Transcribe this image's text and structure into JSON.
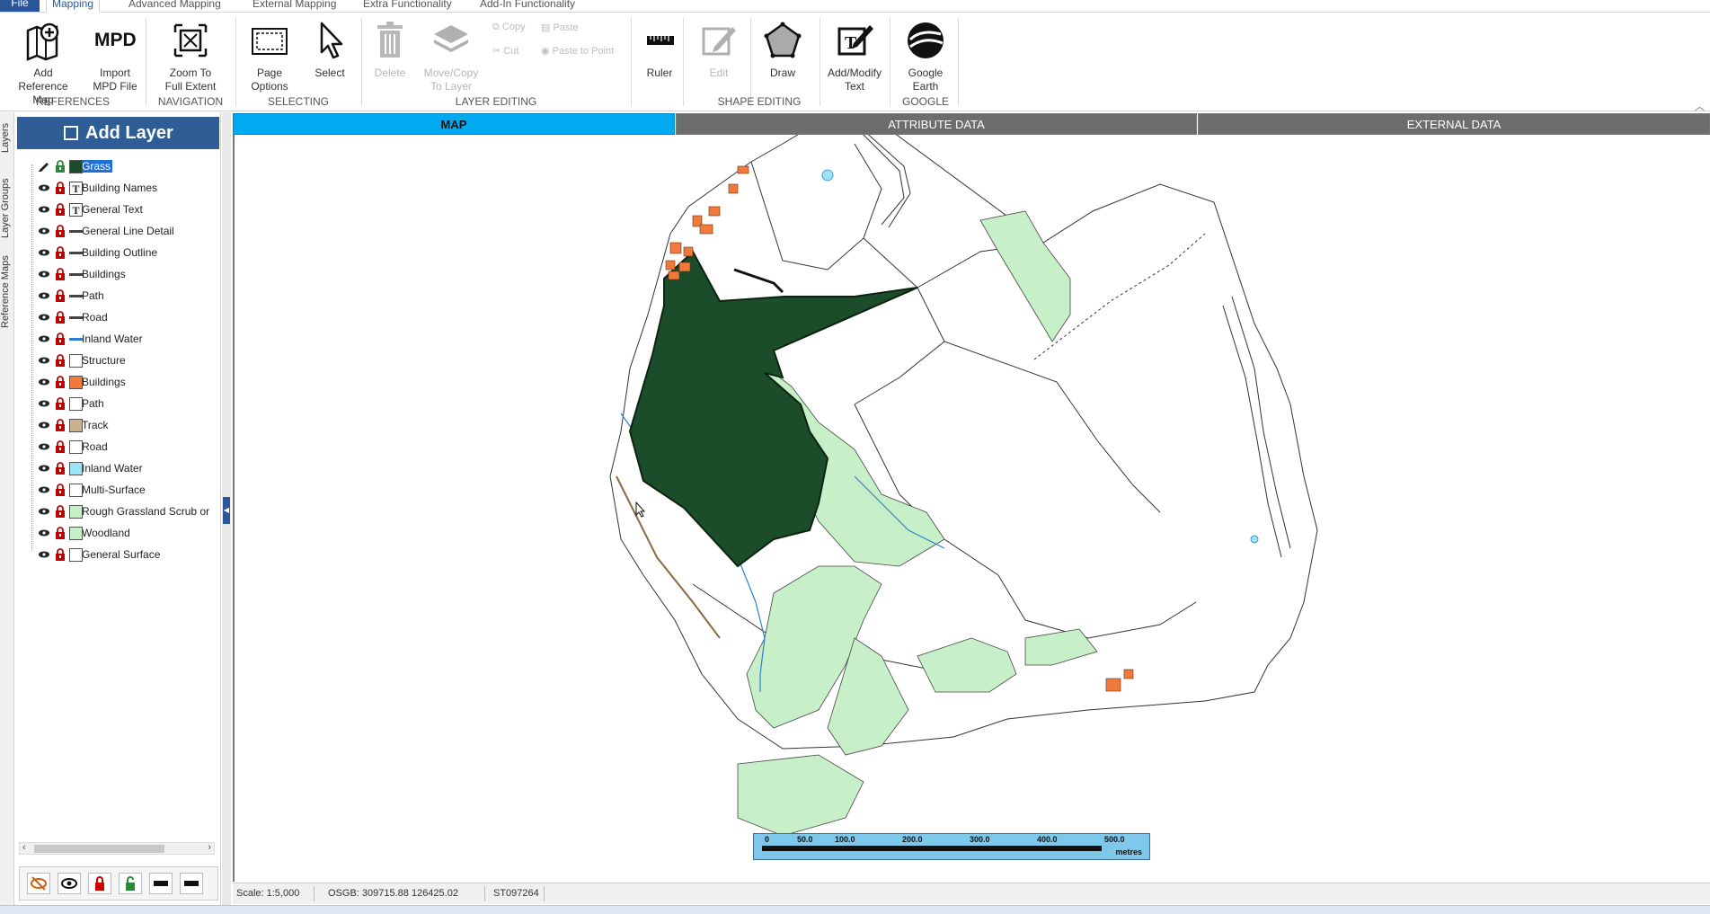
{
  "ribbon_tabs": [
    {
      "label": "File"
    },
    {
      "label": "Mapping"
    },
    {
      "label": "Advanced Mapping"
    },
    {
      "label": "External Mapping"
    },
    {
      "label": "Extra Functionality"
    },
    {
      "label": "Add-In Functionality"
    }
  ],
  "ribbon": {
    "add_reference_map": "Add Reference\nMap",
    "import_mpd": "Import\nMPD File",
    "mpd_icon_text": "MPD",
    "zoom_full_extent": "Zoom To\nFull Extent",
    "page_options": "Page\nOptions",
    "select": "Select",
    "delete": "Delete",
    "move_copy": "Move/Copy\nTo Layer",
    "copy": "Copy",
    "paste": "Paste",
    "cut": "Cut",
    "paste_to_point": "Paste to Point",
    "ruler": "Ruler",
    "edit": "Edit",
    "draw": "Draw",
    "add_modify_text": "Add/Modify\nText",
    "google_earth": "Google\nEarth",
    "groups": {
      "references": "REFERENCES",
      "navigation": "NAVIGATION",
      "selecting": "SELECTING",
      "layer_editing": "LAYER EDITING",
      "shape_editing": "SHAPE EDITING",
      "google": "GOOGLE"
    }
  },
  "side_tabs": {
    "layers": "Layers",
    "layer_groups": "Layer Groups",
    "reference_maps": "Reference Maps"
  },
  "panel": {
    "add_layer": "Add Layer"
  },
  "layers": [
    {
      "name": "Grass",
      "symbol": "fill",
      "color": "#1b4d2a",
      "selected": true
    },
    {
      "name": "Building Names",
      "symbol": "text",
      "color": "#333333"
    },
    {
      "name": "General Text",
      "symbol": "text",
      "color": "#333333"
    },
    {
      "name": "General Line Detail",
      "symbol": "line",
      "color": "#444444"
    },
    {
      "name": "Building Outline",
      "symbol": "line",
      "color": "#444444"
    },
    {
      "name": "Buildings",
      "symbol": "line",
      "color": "#444444"
    },
    {
      "name": "Path",
      "symbol": "line",
      "color": "#444444"
    },
    {
      "name": "Road",
      "symbol": "line",
      "color": "#444444"
    },
    {
      "name": "Inland Water",
      "symbol": "line",
      "color": "#2a7fd4"
    },
    {
      "name": "Structure",
      "symbol": "fill",
      "color": "#ffffff"
    },
    {
      "name": "Buildings",
      "symbol": "fill",
      "color": "#f07a3c"
    },
    {
      "name": "Path",
      "symbol": "fill",
      "color": "#ffffff"
    },
    {
      "name": "Track",
      "symbol": "fill",
      "color": "#cbb28f"
    },
    {
      "name": "Road",
      "symbol": "fill",
      "color": "#ffffff"
    },
    {
      "name": "Inland Water",
      "symbol": "fill",
      "color": "#9be4f8"
    },
    {
      "name": "Multi-Surface",
      "symbol": "fill",
      "color": "#ffffff"
    },
    {
      "name": "Rough Grassland Scrub or",
      "symbol": "fill",
      "color": "#c8f0c8"
    },
    {
      "name": "Woodland",
      "symbol": "fill",
      "color": "#c8f0c8"
    },
    {
      "name": "General Surface",
      "symbol": "fill",
      "color": "#ffffff"
    }
  ],
  "view_tabs": [
    {
      "label": "MAP",
      "active": true
    },
    {
      "label": "ATTRIBUTE DATA",
      "active": false
    },
    {
      "label": "EXTERNAL DATA",
      "active": false
    }
  ],
  "scalebar": {
    "ticks": [
      "0",
      "50.0",
      "100.0",
      "200.0",
      "300.0",
      "400.0",
      "500.0"
    ],
    "unit": "metres"
  },
  "status": {
    "scale": "Scale: 1:5,000",
    "coords": "OSGB: 309715.88  126425.02",
    "grid_ref": "ST097264"
  },
  "colors": {
    "accent": "#2b579a",
    "map_tab": "#00aaf0",
    "grass": "#1b4d2a",
    "woodland": "#c8f0c8",
    "building": "#f07a3c"
  }
}
